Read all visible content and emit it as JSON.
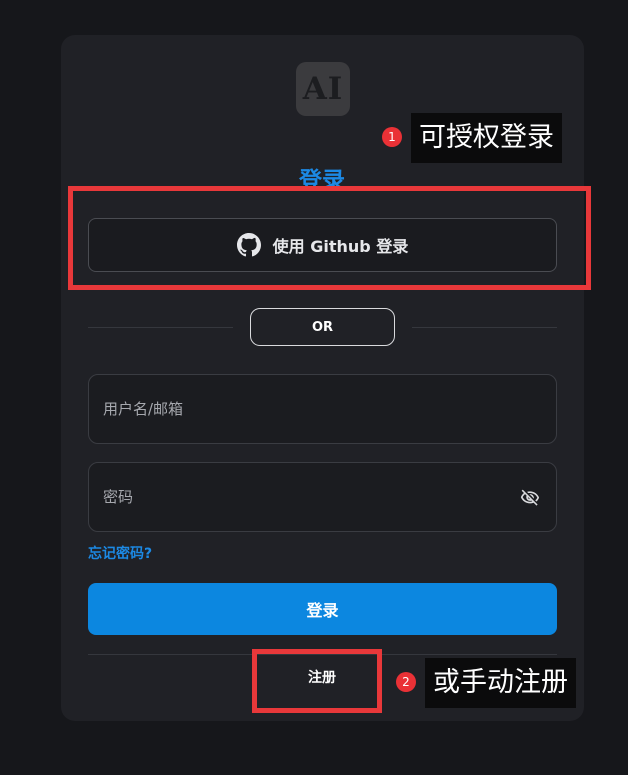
{
  "logo": {
    "text": "AI"
  },
  "page_title": "登录",
  "github_button": {
    "label": "使用 Github 登录",
    "icon": "github-icon"
  },
  "divider": {
    "label": "OR"
  },
  "fields": {
    "username": {
      "placeholder": "用户名/邮箱",
      "value": ""
    },
    "password": {
      "placeholder": "密码",
      "value": "",
      "icon": "eye-off-icon"
    }
  },
  "forgot_link": "忘记密码?",
  "login_button": "登录",
  "register_link": "注册",
  "annotations": [
    {
      "number": "1",
      "text": "可授权登录"
    },
    {
      "number": "2",
      "text": "或手动注册"
    }
  ],
  "colors": {
    "background": "#16171b",
    "card": "#202126",
    "accent": "#0c87e0",
    "link": "#1c89e4",
    "highlight": "#e8383a"
  }
}
